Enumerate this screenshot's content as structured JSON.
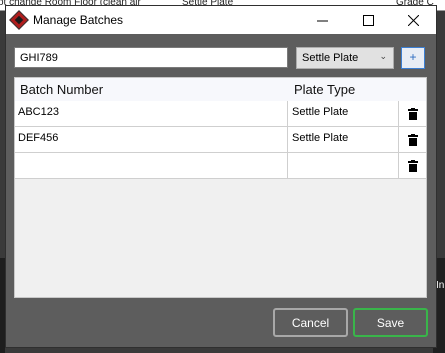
{
  "background": {
    "partial_text": "ot change Room Floor (clean air",
    "partial_text_2": "Settle Plate",
    "partial_text_3": "Grade C",
    "right_edge_text": "In"
  },
  "dialog": {
    "title": "Manage Batches",
    "controls": {
      "minimize": "—",
      "maximize": "☐",
      "close": "✕"
    }
  },
  "form": {
    "batch_input_value": "GHI789",
    "plate_type_selected": "Settle Plate",
    "add_button_label": "+"
  },
  "grid": {
    "headers": {
      "batch_number": "Batch Number",
      "plate_type": "Plate Type"
    },
    "rows": [
      {
        "batch_number": "ABC123",
        "plate_type": "Settle Plate"
      },
      {
        "batch_number": "DEF456",
        "plate_type": "Settle Plate"
      },
      {
        "batch_number": "",
        "plate_type": ""
      }
    ]
  },
  "footer": {
    "cancel_label": "Cancel",
    "save_label": "Save"
  },
  "colors": {
    "accent_save": "#39b54a",
    "add_button_border": "#3c7fd3",
    "dialog_bg": "#5d5d5d"
  }
}
